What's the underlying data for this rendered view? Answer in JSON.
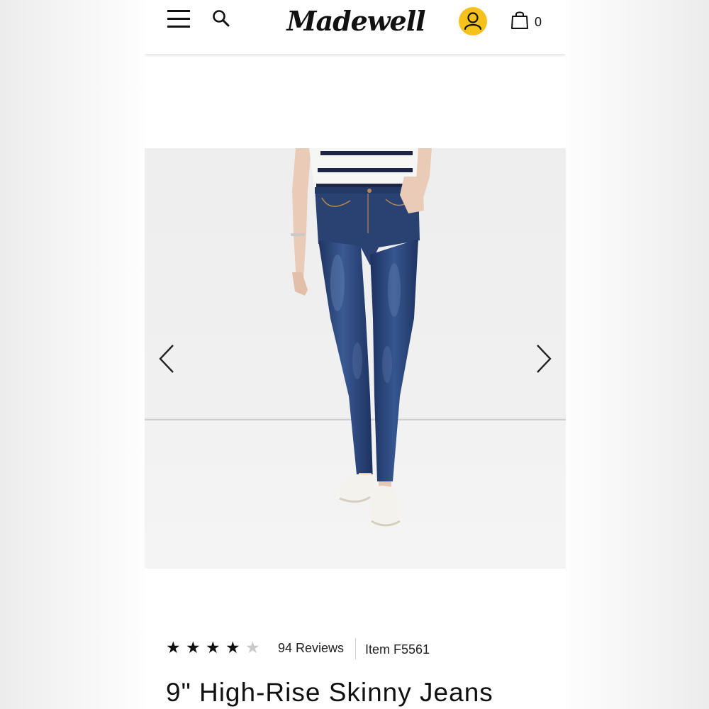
{
  "header": {
    "logo_text": "Madewell",
    "bag_count": "0"
  },
  "gallery": {
    "prev_icon": "chevron-left-icon",
    "next_icon": "chevron-right-icon",
    "image_description_icon": "product-photo"
  },
  "product": {
    "rating": {
      "value": 4,
      "max": 5
    },
    "reviews_label": "94 Reviews",
    "item_label": "Item F5561",
    "title": "9\" High-Rise Skinny Jeans"
  },
  "colors": {
    "accent": "#f5c11a",
    "denim": "#2a4272",
    "text": "#111111"
  }
}
